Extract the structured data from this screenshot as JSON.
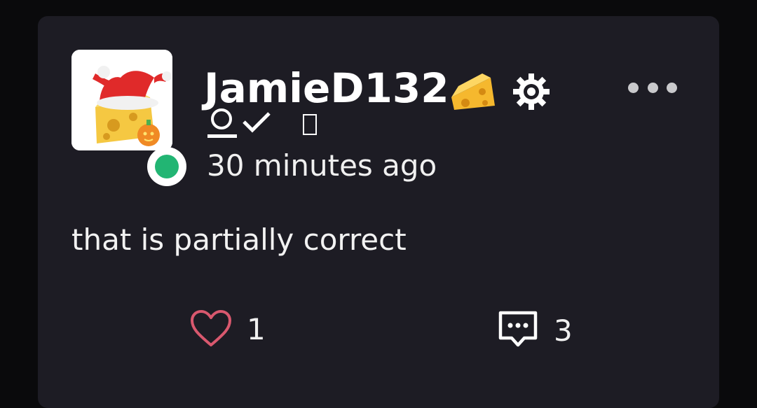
{
  "post": {
    "username": "JamieD132",
    "badges": {
      "cheese_icon": "cheese-emoji-icon",
      "gear_icon": "gear-icon",
      "user_check_icon": "user-verified-icon",
      "missing_glyph": "unknown-glyph-icon"
    },
    "timestamp": "30 minutes ago",
    "content": "that is partially correct",
    "online_status_color": "#22b573",
    "likes": "1",
    "comments": "3",
    "like_icon_color": "#d9586e",
    "accent_text_color": "#ffffff"
  }
}
